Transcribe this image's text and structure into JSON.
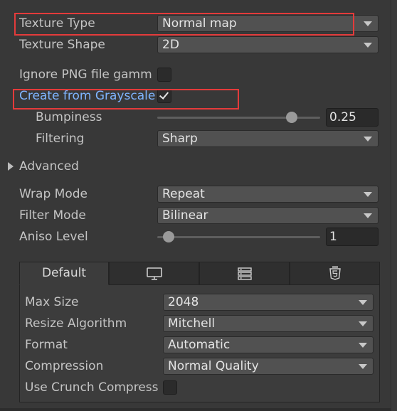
{
  "texture_type": {
    "label": "Texture Type",
    "value": "Normal map"
  },
  "texture_shape": {
    "label": "Texture Shape",
    "value": "2D"
  },
  "ignore_png_gamma": {
    "label": "Ignore PNG file gamm",
    "checked": false
  },
  "create_from_grayscale": {
    "label": "Create from Grayscale",
    "checked": true
  },
  "bumpiness": {
    "label": "Bumpiness",
    "value": "0.25",
    "slider_fraction": 0.81
  },
  "filtering": {
    "label": "Filtering",
    "value": "Sharp"
  },
  "advanced": {
    "label": "Advanced",
    "expanded": false
  },
  "wrap_mode": {
    "label": "Wrap Mode",
    "value": "Repeat"
  },
  "filter_mode": {
    "label": "Filter Mode",
    "value": "Bilinear"
  },
  "aniso_level": {
    "label": "Aniso Level",
    "value": "1",
    "slider_fraction": 0.0
  },
  "platform_tabs": {
    "default_label": "Default",
    "icons": [
      "monitor-icon",
      "server-rack-icon",
      "html5-icon"
    ]
  },
  "platform_settings": {
    "max_size": {
      "label": "Max Size",
      "value": "2048"
    },
    "resize_algorithm": {
      "label": "Resize Algorithm",
      "value": "Mitchell"
    },
    "format": {
      "label": "Format",
      "value": "Automatic"
    },
    "compression": {
      "label": "Compression",
      "value": "Normal Quality"
    },
    "use_crunch": {
      "label": "Use Crunch Compress",
      "checked": false
    }
  },
  "colors": {
    "background": "#383838",
    "highlight": "#e43b3b",
    "link_label": "#7fb4ff"
  }
}
